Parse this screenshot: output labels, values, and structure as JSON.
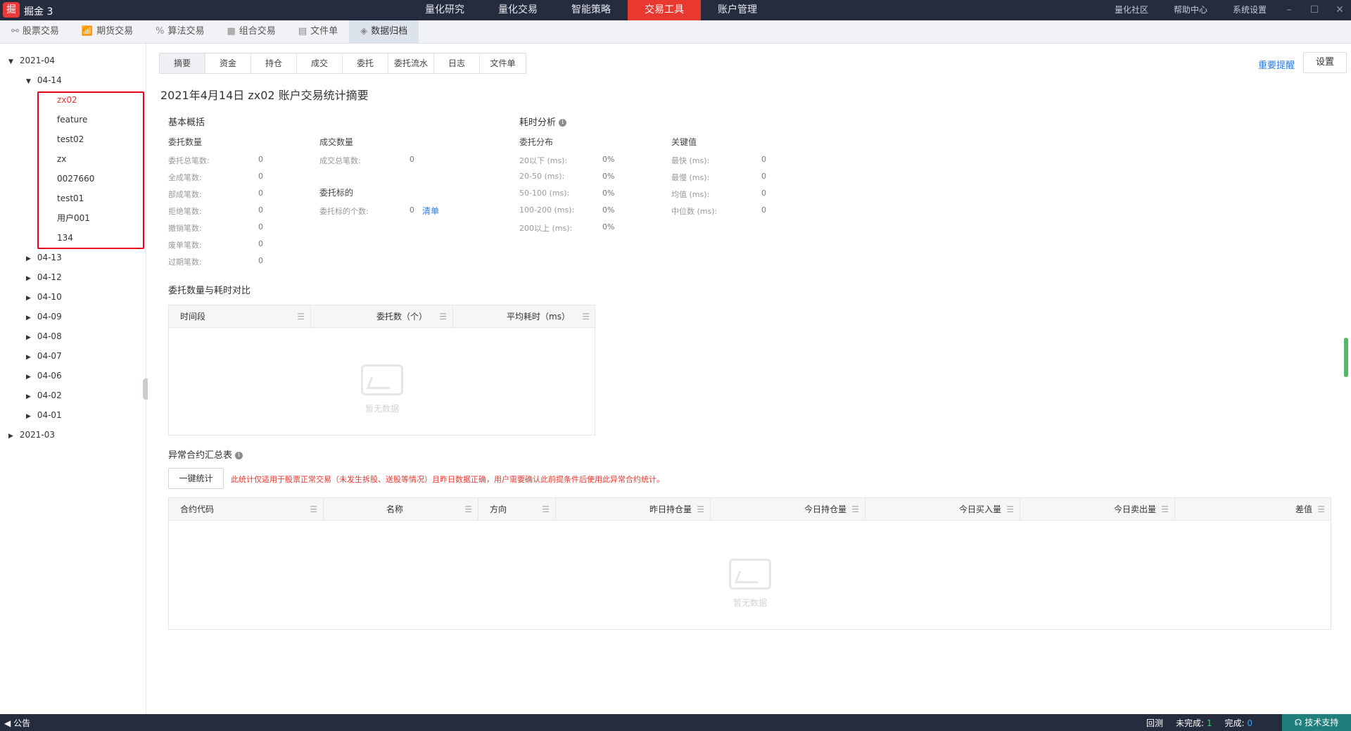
{
  "app": {
    "logo_icon": "掘",
    "name": "掘金 3"
  },
  "main_menu": [
    {
      "label": "量化研究",
      "active": false
    },
    {
      "label": "量化交易",
      "active": false
    },
    {
      "label": "智能策略",
      "active": false
    },
    {
      "label": "交易工具",
      "active": true
    },
    {
      "label": "账户管理",
      "active": false
    }
  ],
  "right_links": [
    "量化社区",
    "帮助中心",
    "系统设置"
  ],
  "window_controls": [
    "minimize-icon",
    "maximize-icon",
    "close-icon"
  ],
  "subnav": [
    {
      "label": "股票交易",
      "icon": "stock-icon",
      "glyph": "⚯",
      "active": false
    },
    {
      "label": "期货交易",
      "icon": "futures-icon",
      "glyph": "📶",
      "active": false
    },
    {
      "label": "算法交易",
      "icon": "algo-icon",
      "glyph": "%",
      "active": false
    },
    {
      "label": "组合交易",
      "icon": "portfolio-icon",
      "glyph": "▦",
      "active": false
    },
    {
      "label": "文件单",
      "icon": "file-icon",
      "glyph": "▤",
      "active": false
    },
    {
      "label": "数据归档",
      "icon": "layers-icon",
      "glyph": "◈",
      "active": true
    }
  ],
  "tree": {
    "root_2021_04": "2021-04",
    "day_0414": "04-14",
    "accounts": [
      "zx02",
      "feature",
      "test02",
      "zx",
      "0027660",
      "test01",
      "用户001",
      "134"
    ],
    "selected_account": "zx02",
    "other_days": [
      "04-13",
      "04-12",
      "04-10",
      "04-09",
      "04-08",
      "04-07",
      "04-06",
      "04-02",
      "04-01"
    ],
    "root_2021_03": "2021-03"
  },
  "tabs": [
    "摘要",
    "资金",
    "持仓",
    "成交",
    "委托",
    "委托流水",
    "日志",
    "文件单"
  ],
  "active_tab": "摘要",
  "important_link": "重要提醒",
  "settings_label": "设置",
  "page_title": "2021年4月14日 zx02 账户交易统计摘要",
  "basic": {
    "title": "基本概括",
    "orders_title": "委托数量",
    "orders": [
      {
        "label": "委托总笔数:",
        "value": "0"
      },
      {
        "label": "全成笔数:",
        "value": "0"
      },
      {
        "label": "部成笔数:",
        "value": "0"
      },
      {
        "label": "拒绝笔数:",
        "value": "0"
      },
      {
        "label": "撤销笔数:",
        "value": "0"
      },
      {
        "label": "废单笔数:",
        "value": "0"
      },
      {
        "label": "过期笔数:",
        "value": "0"
      }
    ],
    "trades_title": "成交数量",
    "trades": [
      {
        "label": "成交总笔数:",
        "value": "0"
      }
    ],
    "symbols_title": "委托标的",
    "symbols": {
      "label": "委托标的个数:",
      "value": "0",
      "link": "清单"
    }
  },
  "latency": {
    "title": "耗时分析",
    "dist_title": "委托分布",
    "dist": [
      {
        "label": "20以下 (ms):",
        "value": "0%"
      },
      {
        "label": "20-50 (ms):",
        "value": "0%"
      },
      {
        "label": "50-100 (ms):",
        "value": "0%"
      },
      {
        "label": "100-200 (ms):",
        "value": "0%"
      },
      {
        "label": "200以上 (ms):",
        "value": "0%"
      }
    ],
    "key_title": "关键值",
    "key": [
      {
        "label": "最快 (ms):",
        "value": "0"
      },
      {
        "label": "最慢 (ms):",
        "value": "0"
      },
      {
        "label": "均值 (ms):",
        "value": "0"
      },
      {
        "label": "中位数 (ms):",
        "value": "0"
      }
    ]
  },
  "compare": {
    "title": "委托数量与耗时对比",
    "columns": [
      "时间段",
      "委托数（个）",
      "平均耗时（ms）"
    ],
    "empty_text": "暂无数据"
  },
  "abnormal": {
    "title": "异常合约汇总表",
    "button": "一键统计",
    "warning": "此统计仅适用于股票正常交易（未发生拆股、送股等情况）且昨日数据正确，用户需要确认此前提条件后使用此异常合约统计。",
    "columns": [
      "合约代码",
      "名称",
      "方向",
      "昨日持仓量",
      "今日持仓量",
      "今日买入量",
      "今日卖出量",
      "差值"
    ],
    "empty_text": "暂无数据"
  },
  "statusbar": {
    "notice": "公告",
    "backtest": "回测",
    "pending_label": "未完成:",
    "pending_value": "1",
    "done_label": "完成:",
    "done_value": "0",
    "support": "技术支持"
  },
  "colors": {
    "accent_red": "#e8382f",
    "titlebar_bg": "#242c3d",
    "link_blue": "#2b7be2",
    "highlight_box": "#e8001c"
  }
}
